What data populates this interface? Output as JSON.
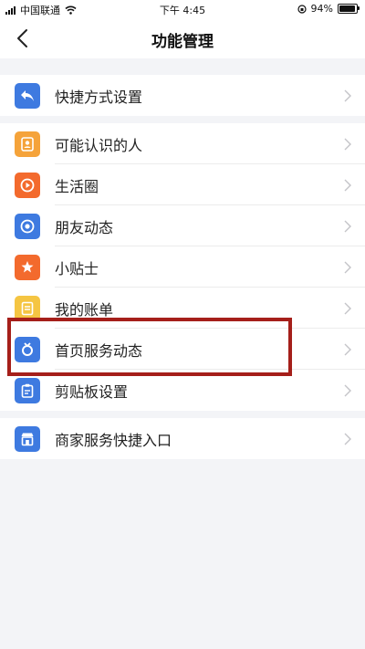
{
  "status_bar": {
    "carrier": "中国联通",
    "time": "下午 4:45",
    "battery": "94%",
    "battery_level": 0.94
  },
  "nav": {
    "title": "功能管理",
    "back_icon": "chevron-left-icon"
  },
  "groups": [
    {
      "items": [
        {
          "label": "快捷方式设置",
          "icon": "share-back-icon",
          "color": "#3e7ae0"
        }
      ]
    },
    {
      "items": [
        {
          "label": "可能认识的人",
          "icon": "contact-card-icon",
          "color": "#f5a33a"
        },
        {
          "label": "生活圈",
          "icon": "play-circle-icon",
          "color": "#f36a2d"
        },
        {
          "label": "朋友动态",
          "icon": "camera-shutter-icon",
          "color": "#3e7ae0"
        },
        {
          "label": "小贴士",
          "icon": "star-pen-icon",
          "color": "#f36a2d"
        },
        {
          "label": "我的账单",
          "icon": "bill-list-icon",
          "color": "#f5c542"
        },
        {
          "label": "首页服务动态",
          "icon": "ring-badge-icon",
          "color": "#3e7ae0"
        },
        {
          "label": "剪贴板设置",
          "icon": "clipboard-icon",
          "color": "#3e7ae0"
        }
      ]
    },
    {
      "items": [
        {
          "label": "商家服务快捷入口",
          "icon": "storefront-icon",
          "color": "#3e7ae0"
        }
      ]
    }
  ],
  "annotation": {
    "highlight_color": "#a51f1a"
  }
}
